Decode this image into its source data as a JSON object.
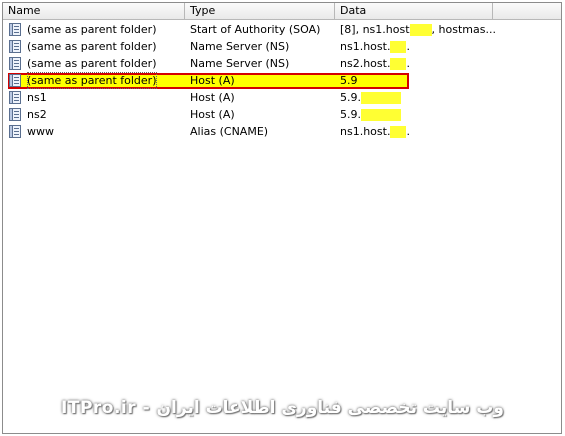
{
  "columns": {
    "name": "Name",
    "type": "Type",
    "data": "Data"
  },
  "records": [
    {
      "name": "(same as parent folder)",
      "type": "Start of Authority (SOA)",
      "data_prefix": "[8], ns1.host",
      "data_suffix": ", hostmas...",
      "highlight_width": 22
    },
    {
      "name": "(same as parent folder)",
      "type": "Name Server (NS)",
      "data_prefix": "ns1.host.",
      "data_suffix": ".",
      "highlight_width": 16
    },
    {
      "name": "(same as parent folder)",
      "type": "Name Server (NS)",
      "data_prefix": "ns2.host.",
      "data_suffix": ".",
      "highlight_width": 16
    },
    {
      "name": "(same as parent folder)",
      "type": "Host (A)",
      "data_prefix": "5.9",
      "data_suffix": "",
      "highlight_width": 0,
      "selected": true
    },
    {
      "name": "ns1",
      "type": "Host (A)",
      "data_prefix": "5.9.",
      "data_suffix": "",
      "highlight_width": 40
    },
    {
      "name": "ns2",
      "type": "Host (A)",
      "data_prefix": "5.9.",
      "data_suffix": "",
      "highlight_width": 40
    },
    {
      "name": "www",
      "type": "Alias (CNAME)",
      "data_prefix": "ns1.host.",
      "data_suffix": ".",
      "highlight_width": 16
    }
  ],
  "watermark": "ITPro.ir - وب سایت تخصصی فناوری اطلاعات ایران",
  "colors": {
    "highlight": "#ffff00",
    "selection_border": "#d40000"
  },
  "icons": {
    "record": "dns-record-icon"
  }
}
